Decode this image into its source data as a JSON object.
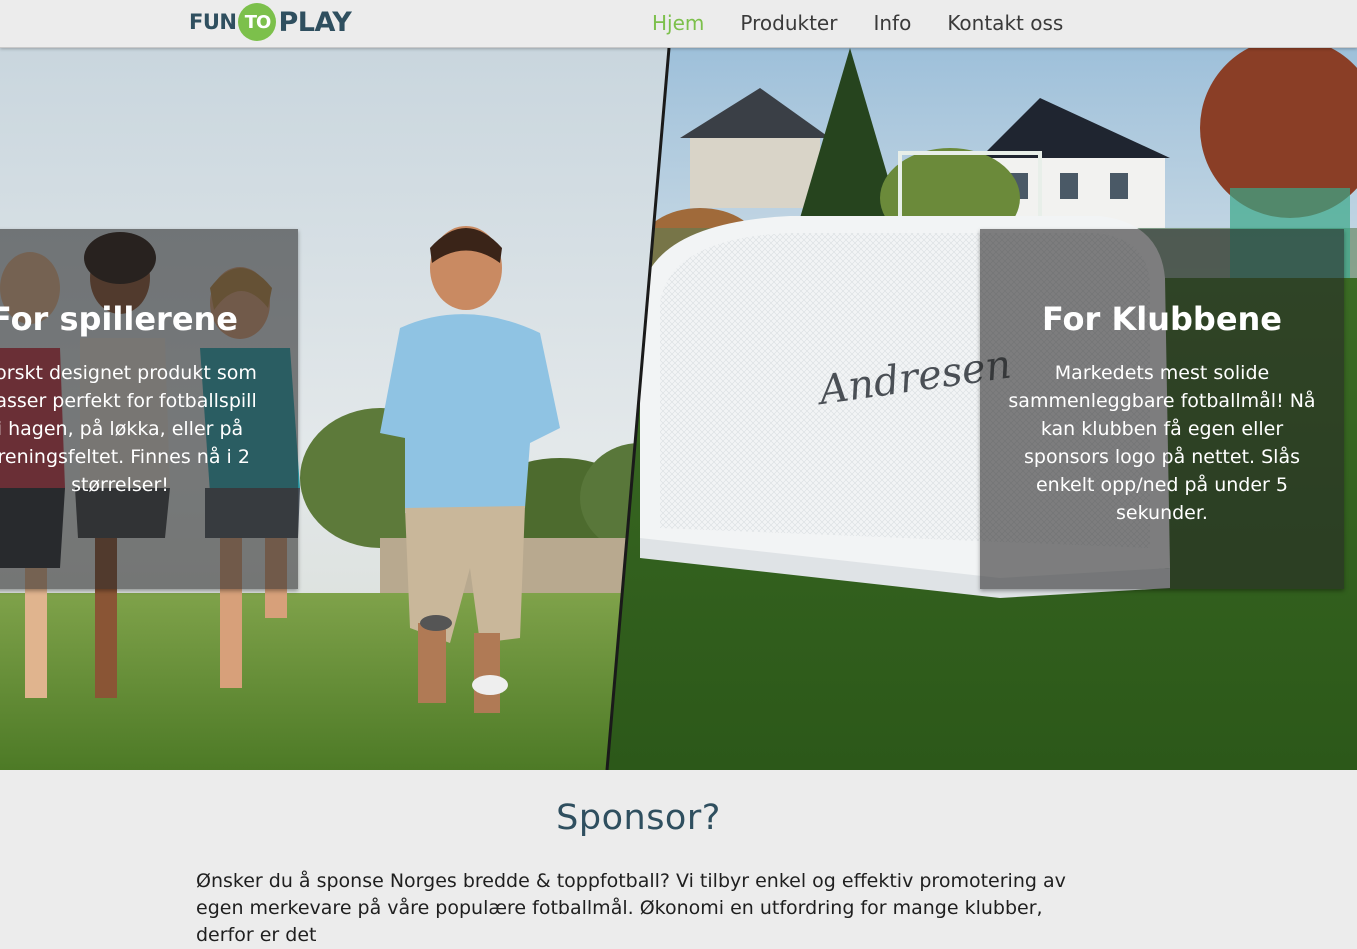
{
  "nav": {
    "logo": {
      "fun": "FUN",
      "to": "TO",
      "play": "PLAY"
    },
    "links": [
      "Hjem",
      "Produkter",
      "Info",
      "Kontakt oss"
    ],
    "active_index": 0
  },
  "hero": {
    "left": {
      "title": "For spillerene",
      "text": "norskt designet produkt som passer perfekt for fotballspill i hagen, på løkka, eller på treningsfeltet. Finnes nå i 2 størrelser!"
    },
    "right": {
      "title": "For Klubbene",
      "text": "Markedets mest solide sammenleggbare fotballmål! Nå kan klubben få egen eller sponsors logo på nettet. Slås enkelt opp/ned på under 5 sekunder.",
      "net_brand": "Andresen"
    }
  },
  "sponsor": {
    "title": "Sponsor?",
    "text": "Ønsker du å sponse Norges bredde & toppfotball? Vi tilbyr enkel og effektiv promotering av egen merkevare på våre populære fotballmål. Økonomi en utfordring for mange klubber, derfor er det"
  },
  "colors": {
    "accent": "#7cc04b",
    "brand_dark": "#2f4f5f",
    "background": "#ececec"
  }
}
